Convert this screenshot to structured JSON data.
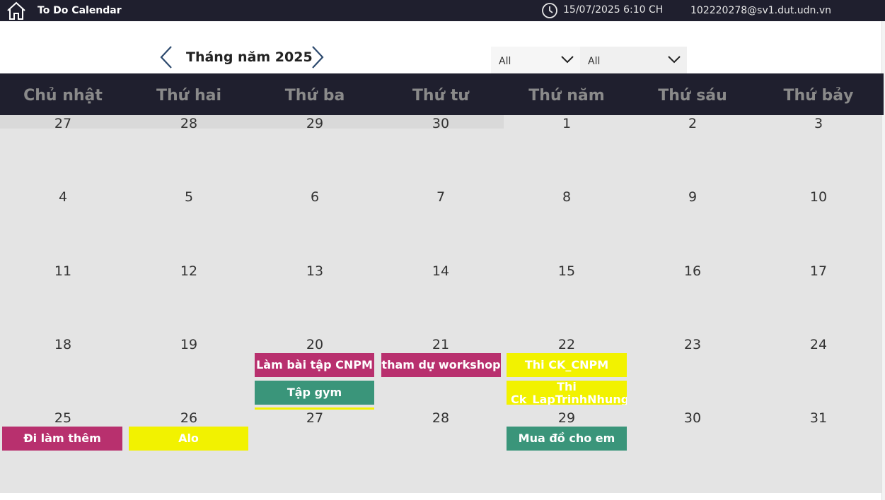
{
  "topbar": {
    "title": "To Do Calendar",
    "datetime": "15/07/2025 6:10 CH",
    "email": "102220278@sv1.dut.udn.vn"
  },
  "nav": {
    "month_title": "Tháng năm 2025"
  },
  "filters": [
    {
      "value": "All"
    },
    {
      "value": "All"
    }
  ],
  "weekdays": [
    "Chủ nhật",
    "Thứ hai",
    "Thứ ba",
    "Thứ tư",
    "Thứ năm",
    "Thứ sáu",
    "Thứ bảy"
  ],
  "weeks": [
    [
      "27",
      "28",
      "29",
      "30",
      "1",
      "2",
      "3"
    ],
    [
      "4",
      "5",
      "6",
      "7",
      "8",
      "9",
      "10"
    ],
    [
      "11",
      "12",
      "13",
      "14",
      "15",
      "16",
      "17"
    ],
    [
      "18",
      "19",
      "20",
      "21",
      "22",
      "23",
      "24"
    ],
    [
      "25",
      "26",
      "27",
      "28",
      "29",
      "30",
      "31"
    ]
  ],
  "events": [
    {
      "label": "Làm bài tập CNPM",
      "color": "#b8306e"
    },
    {
      "label": "Tập gym",
      "color": "#3a957a"
    },
    {
      "label": "tham dự workshop",
      "color": "#b8306e"
    },
    {
      "label": "Thi CK_CNPM",
      "color": "#f2f200"
    },
    {
      "label": "Thi Ck_LapTrinhNhung",
      "color": "#f2f200"
    },
    {
      "label": "Đi làm thêm",
      "color": "#b8306e"
    },
    {
      "label": "Alo",
      "color": "#f2f200"
    },
    {
      "label": "Mua đồ cho em",
      "color": "#3a957a"
    }
  ]
}
